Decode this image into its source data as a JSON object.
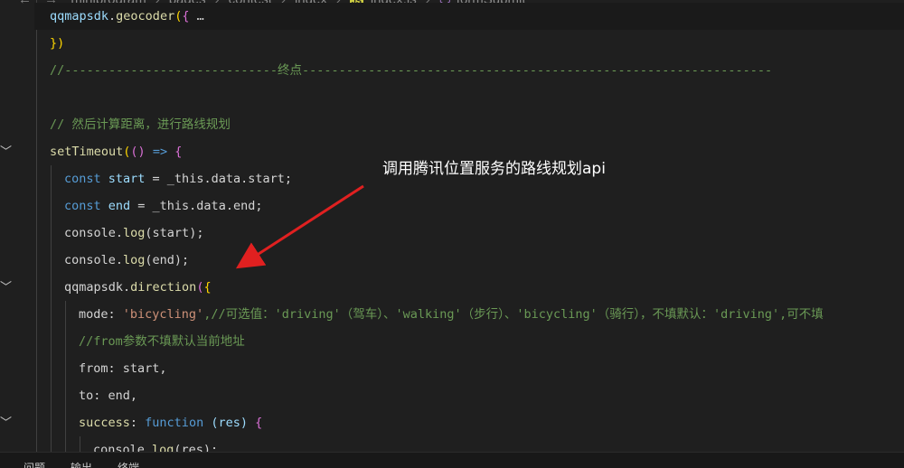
{
  "breadcrumb": {
    "items": [
      "miniprogram",
      "pages",
      "contest",
      "index"
    ],
    "file_badge": "JS",
    "file": "index.js",
    "symbol": "formSubmit"
  },
  "code": {
    "l1_obj": "qqmapsdk",
    "l1_fn": "geocoder",
    "l1_paren": "(",
    "l1_brace": "{",
    "l1_fold": "…",
    "l2_close": "})",
    "l3_comment": "//-----------------------------终点----------------------------------------------------------------",
    "l5_comment": "// 然后计算距离，进行路线规划",
    "l6_fn": "setTimeout",
    "l6_open": "(",
    "l6_args": "()",
    "l6_arrow": " => ",
    "l6_brace": "{",
    "l7_kw": "const",
    "l7_var": " start",
    "l7_rest": " = _this.data.start;",
    "l8_kw": "const",
    "l8_var": " end",
    "l8_rest": " = _this.data.end;",
    "l9_obj": "console.",
    "l9_fn": "log",
    "l9_rest": "(start);",
    "l10_obj": "console.",
    "l10_fn": "log",
    "l10_rest": "(end);",
    "l11_obj": "qqmapsdk.",
    "l11_fn": "direction",
    "l11_open": "(",
    "l11_brace": "{",
    "l12_key": "mode",
    "l12_colon": ": ",
    "l12_val": "'bicycling'",
    "l12_comment": ",//可选值：'driving'（驾车）、'walking'（步行）、'bicycling'（骑行），不填默认：'driving',可不填",
    "l13_comment": "//from参数不填默认当前地址",
    "l14_key": "from",
    "l14_rest": ": start,",
    "l15_key": "to",
    "l15_rest": ": end,",
    "l16_key": "success",
    "l16_colon": ": ",
    "l16_kw": "function",
    "l16_params": " (res) ",
    "l16_brace": "{",
    "l17_obj": "console.",
    "l17_fn": "log",
    "l17_rest": "(res);"
  },
  "annotation": {
    "text": "调用腾讯位置服务的路线规划api",
    "arrow_color": "#e02020"
  },
  "panel": {
    "tabs": [
      "问题",
      "输出",
      "终端"
    ]
  },
  "colors": {
    "background": "#1f1f1f",
    "keyword": "#569cd6",
    "function": "#dcdcaa",
    "string": "#ce9178",
    "comment": "#6a9955"
  }
}
